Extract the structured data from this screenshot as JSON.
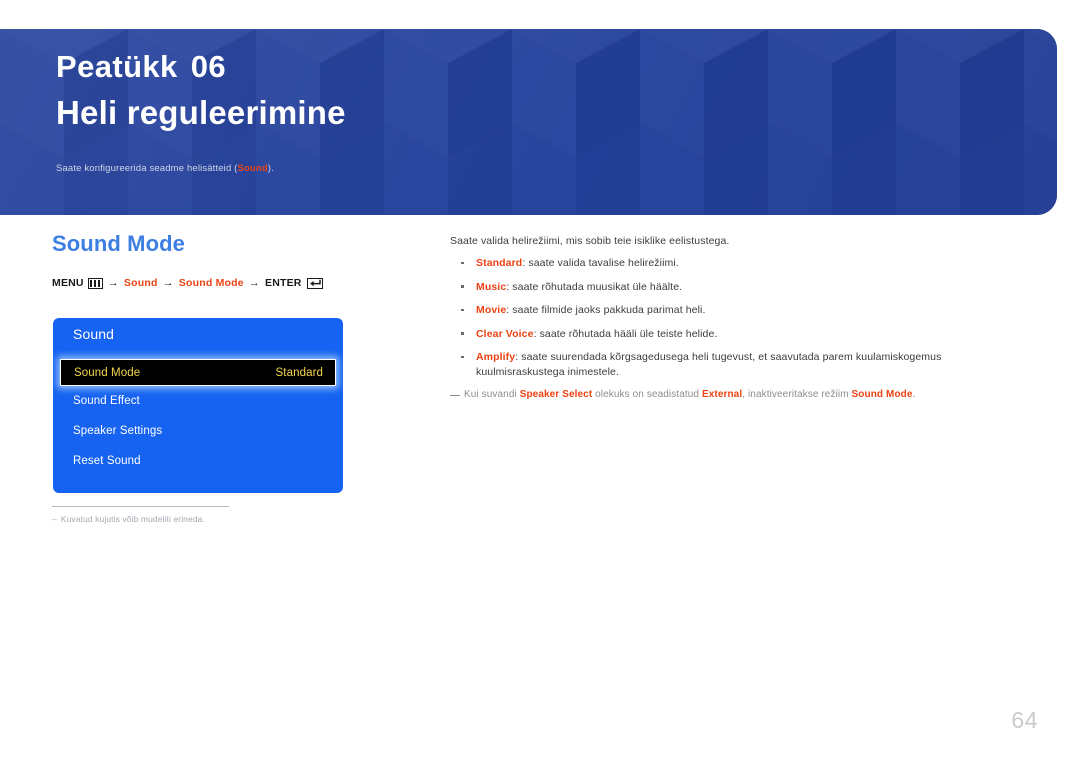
{
  "banner": {
    "chapter_label": "Peatükk",
    "chapter_number": "06",
    "title": "Heli reguleerimine",
    "subtitle_before": "Saate konfigureerida seadme helisätteid (",
    "subtitle_keyword": "Sound",
    "subtitle_after": ").",
    "bg_color": "#23409b",
    "keyword_color": "#eb4314"
  },
  "section": {
    "heading": "Sound Mode",
    "heading_color": "#3d7fe3"
  },
  "menu_path": {
    "menu_label": "MENU",
    "menu_icon": "menu-grid-icon",
    "arrow": "→",
    "step1": "Sound",
    "step2": "Sound Mode",
    "enter_label": "ENTER",
    "enter_icon": "enter-return-icon",
    "accent_color": "#eb4314"
  },
  "osd": {
    "title": "Sound",
    "panel_color": "#1763f1",
    "selected_bg": "#000000",
    "selected_text": "#f5d44a",
    "rows": [
      {
        "label": "Sound Mode",
        "value": "Standard",
        "selected": true
      },
      {
        "label": "Sound Effect",
        "value": "",
        "selected": false
      },
      {
        "label": "Speaker Settings",
        "value": "",
        "selected": false
      },
      {
        "label": "Reset Sound",
        "value": "",
        "selected": false
      }
    ]
  },
  "panel_note": {
    "dash": "‒",
    "text": "Kuvatud kujutis võib mudeliti erineda."
  },
  "content": {
    "intro": "Saate valida helirežiimi, mis sobib teie isiklike eelistustega.",
    "bullets": [
      {
        "term": "Standard",
        "text": ": saate valida tavalise helirežiimi."
      },
      {
        "term": "Music",
        "text": ": saate rõhutada muusikat üle häälte."
      },
      {
        "term": "Movie",
        "text": ": saate filmide jaoks pakkuda parimat heli."
      },
      {
        "term": "Clear Voice",
        "text": ": saate rõhutada hääli üle teiste helide."
      },
      {
        "term": "Amplify",
        "text": ": saate suurendada kõrgsagedusega heli tugevust, et saavutada parem kuulamiskogemus kuulmisraskustega inimestele."
      }
    ],
    "note": {
      "p1": "Kui suvandi ",
      "kw1": "Speaker Select",
      "p2": " olekuks on seadistatud ",
      "kw2": "External",
      "p3": ", inaktiveeritakse režiim ",
      "kw3": "Sound Mode",
      "p4": "."
    }
  },
  "footer": {
    "page_number": "64"
  }
}
